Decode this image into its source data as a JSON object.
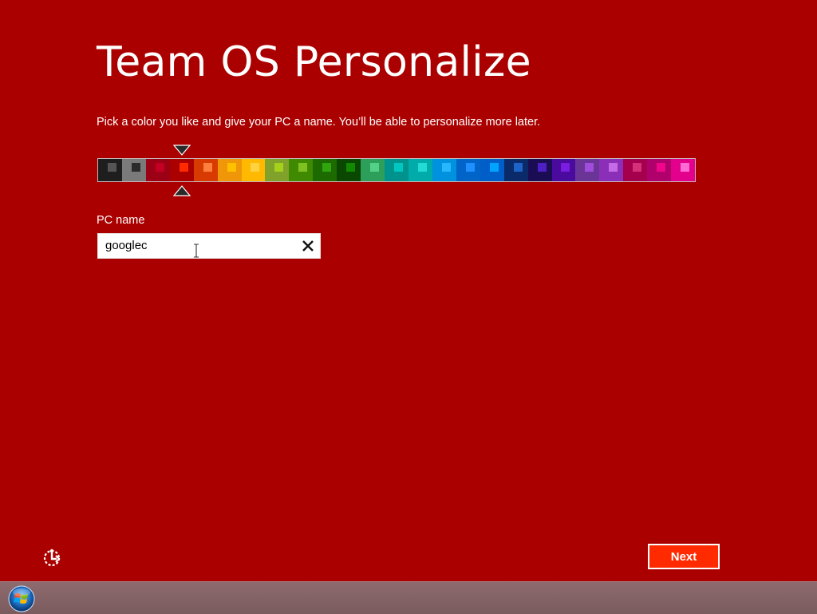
{
  "title": "Team OS Personalize",
  "subtitle": "Pick a color you like and give your PC a name. You’ll be able to personalize more later.",
  "colors": {
    "background": "#ab0000",
    "next_button": "#ff2a00",
    "selected_index": 3,
    "swatches": [
      {
        "bg": "#1e1e1e",
        "accent": "#555555"
      },
      {
        "bg": "#7a7a7a",
        "accent": "#2b2b2b"
      },
      {
        "bg": "#9c0014",
        "accent": "#c30022"
      },
      {
        "bg": "#ab0000",
        "accent": "#ff2a00"
      },
      {
        "bg": "#d83b01",
        "accent": "#ff7f3f"
      },
      {
        "bg": "#f09609",
        "accent": "#ffc000"
      },
      {
        "bg": "#ffb900",
        "accent": "#ffd33f"
      },
      {
        "bg": "#80a12a",
        "accent": "#a4d11b"
      },
      {
        "bg": "#3f8a00",
        "accent": "#7fc21f"
      },
      {
        "bg": "#1d6a00",
        "accent": "#2fa60e"
      },
      {
        "bg": "#0a4700",
        "accent": "#118a00"
      },
      {
        "bg": "#2e9f5b",
        "accent": "#54d189"
      },
      {
        "bg": "#00928c",
        "accent": "#00c7c0"
      },
      {
        "bg": "#00aba9",
        "accent": "#22dbd6"
      },
      {
        "bg": "#0091df",
        "accent": "#27b7ff"
      },
      {
        "bg": "#0064c8",
        "accent": "#1e90ff"
      },
      {
        "bg": "#005ec9",
        "accent": "#00a4ff"
      },
      {
        "bg": "#0a2a6a",
        "accent": "#1e63c8"
      },
      {
        "bg": "#1b0d54",
        "accent": "#4e1fc4"
      },
      {
        "bg": "#4a0a9e",
        "accent": "#7a1de0"
      },
      {
        "bg": "#6a3596",
        "accent": "#a04ddd"
      },
      {
        "bg": "#8b2fb8",
        "accent": "#c56be8"
      },
      {
        "bg": "#a4004d",
        "accent": "#d4317a"
      },
      {
        "bg": "#b0006b",
        "accent": "#f0068b"
      },
      {
        "bg": "#e3008c",
        "accent": "#ff6ad5"
      }
    ]
  },
  "pc_name": {
    "label": "PC name",
    "value": "googlec",
    "clear_icon": "close-icon"
  },
  "footer": {
    "ease_of_access_icon": "ease-of-access-icon",
    "next_label": "Next"
  },
  "taskbar": {
    "start_icon": "windows-start-orb-icon"
  }
}
